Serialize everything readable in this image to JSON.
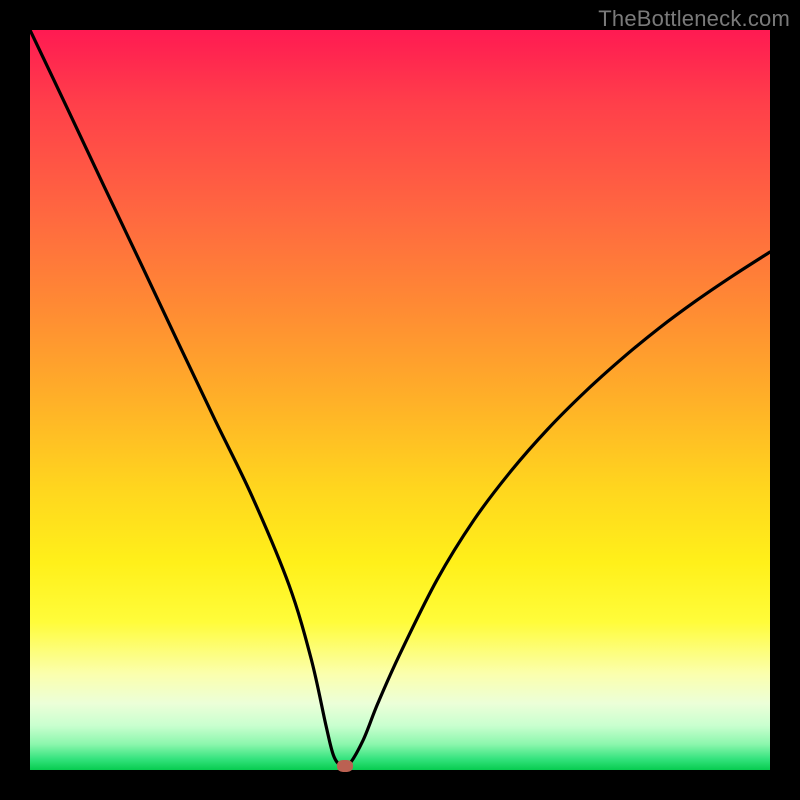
{
  "watermark": "TheBottleneck.com",
  "chart_data": {
    "type": "line",
    "title": "",
    "xlabel": "",
    "ylabel": "",
    "xlim": [
      0,
      100
    ],
    "ylim": [
      0,
      100
    ],
    "grid": false,
    "series": [
      {
        "name": "bottleneck-curve",
        "x": [
          0,
          5,
          10,
          15,
          20,
          25,
          30,
          35,
          38,
          40,
          41,
          42,
          43,
          45,
          47,
          50,
          55,
          60,
          65,
          70,
          75,
          80,
          85,
          90,
          95,
          100
        ],
        "y": [
          100,
          89.5,
          78.9,
          68.4,
          57.8,
          47.3,
          37.0,
          25.0,
          15.0,
          6.0,
          2.0,
          0.6,
          0.6,
          4.0,
          9.0,
          15.7,
          25.7,
          33.8,
          40.4,
          46.1,
          51.1,
          55.6,
          59.7,
          63.4,
          66.8,
          70.0
        ]
      }
    ],
    "annotations": [
      {
        "name": "optimal-marker",
        "x": 42.5,
        "y": 0.5,
        "color": "#bb6152"
      }
    ],
    "gradient_stops": [
      {
        "pos": 0.0,
        "color": "#ff1a52"
      },
      {
        "pos": 0.25,
        "color": "#ff6840"
      },
      {
        "pos": 0.5,
        "color": "#ffb028"
      },
      {
        "pos": 0.72,
        "color": "#fff01a"
      },
      {
        "pos": 0.87,
        "color": "#fbffad"
      },
      {
        "pos": 0.97,
        "color": "#8cf7ad"
      },
      {
        "pos": 1.0,
        "color": "#07cc4f"
      }
    ]
  }
}
